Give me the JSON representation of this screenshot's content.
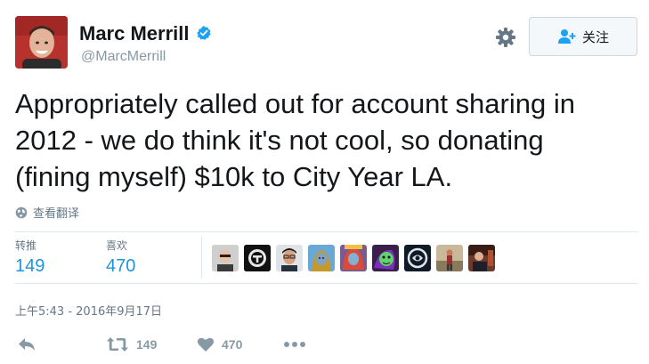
{
  "author": {
    "display_name": "Marc Merrill",
    "handle": "@MarcMerrill",
    "verified": true
  },
  "follow_button": {
    "label": "关注"
  },
  "tweet": {
    "lines": [
      "Appropriately called out for account sharing in",
      "2012 - we do think it's not cool, so donating",
      "(fining myself) $10k to City Year LA."
    ]
  },
  "translate": {
    "label": "查看翻译"
  },
  "stats": {
    "retweets": {
      "label": "转推",
      "value": "149"
    },
    "likes": {
      "label": "喜欢",
      "value": "470"
    }
  },
  "timestamp": "上午5:43 - 2016年9月17日",
  "actions": {
    "reply_icon": "reply-icon",
    "retweet_count": "149",
    "like_count": "470",
    "more_icon": "more-icon"
  },
  "colors": {
    "link_blue": "#1b95e0",
    "muted": "#8899a6",
    "verified": "#1da1f2"
  }
}
